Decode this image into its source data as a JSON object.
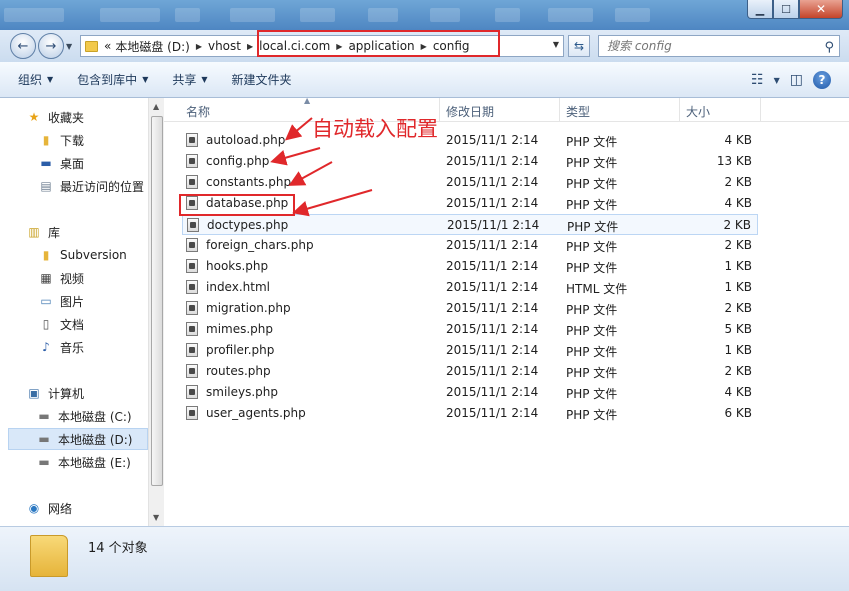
{
  "window": {
    "search_placeholder": "搜索 config"
  },
  "address": {
    "overflow": "«",
    "crumbs": [
      "本地磁盘 (D:)",
      "vhost",
      "local.ci.com",
      "application",
      "config"
    ]
  },
  "toolbar": {
    "organize": "组织",
    "include_in_library": "包含到库中",
    "share": "共享",
    "new_folder": "新建文件夹"
  },
  "sidebar": {
    "items": [
      {
        "label": "收藏夹",
        "icon": "star-icon"
      },
      {
        "label": "下载",
        "icon": "folder-icon"
      },
      {
        "label": "桌面",
        "icon": "desktop-icon"
      },
      {
        "label": "最近访问的位置",
        "icon": "recent-icon"
      },
      {
        "label": "库",
        "icon": "library-icon"
      },
      {
        "label": "Subversion",
        "icon": "folder-icon"
      },
      {
        "label": "视频",
        "icon": "video-icon"
      },
      {
        "label": "图片",
        "icon": "picture-icon"
      },
      {
        "label": "文档",
        "icon": "document-icon"
      },
      {
        "label": "音乐",
        "icon": "music-icon"
      },
      {
        "label": "计算机",
        "icon": "computer-icon"
      },
      {
        "label": "本地磁盘 (C:)",
        "icon": "drive-icon"
      },
      {
        "label": "本地磁盘 (D:)",
        "icon": "drive-icon"
      },
      {
        "label": "本地磁盘 (E:)",
        "icon": "drive-icon"
      },
      {
        "label": "网络",
        "icon": "network-icon"
      }
    ]
  },
  "columns": {
    "name": "名称",
    "modified": "修改日期",
    "type": "类型",
    "size": "大小"
  },
  "files": [
    {
      "name": "autoload.php",
      "modified": "2015/11/1 2:14",
      "type": "PHP 文件",
      "size": "4 KB"
    },
    {
      "name": "config.php",
      "modified": "2015/11/1 2:14",
      "type": "PHP 文件",
      "size": "13 KB"
    },
    {
      "name": "constants.php",
      "modified": "2015/11/1 2:14",
      "type": "PHP 文件",
      "size": "2 KB"
    },
    {
      "name": "database.php",
      "modified": "2015/11/1 2:14",
      "type": "PHP 文件",
      "size": "4 KB"
    },
    {
      "name": "doctypes.php",
      "modified": "2015/11/1 2:14",
      "type": "PHP 文件",
      "size": "2 KB"
    },
    {
      "name": "foreign_chars.php",
      "modified": "2015/11/1 2:14",
      "type": "PHP 文件",
      "size": "2 KB"
    },
    {
      "name": "hooks.php",
      "modified": "2015/11/1 2:14",
      "type": "PHP 文件",
      "size": "1 KB"
    },
    {
      "name": "index.html",
      "modified": "2015/11/1 2:14",
      "type": "HTML 文件",
      "size": "1 KB"
    },
    {
      "name": "migration.php",
      "modified": "2015/11/1 2:14",
      "type": "PHP 文件",
      "size": "2 KB"
    },
    {
      "name": "mimes.php",
      "modified": "2015/11/1 2:14",
      "type": "PHP 文件",
      "size": "5 KB"
    },
    {
      "name": "profiler.php",
      "modified": "2015/11/1 2:14",
      "type": "PHP 文件",
      "size": "1 KB"
    },
    {
      "name": "routes.php",
      "modified": "2015/11/1 2:14",
      "type": "PHP 文件",
      "size": "2 KB"
    },
    {
      "name": "smileys.php",
      "modified": "2015/11/1 2:14",
      "type": "PHP 文件",
      "size": "4 KB"
    },
    {
      "name": "user_agents.php",
      "modified": "2015/11/1 2:14",
      "type": "PHP 文件",
      "size": "6 KB"
    }
  ],
  "annotation": {
    "text": "自动载入配置",
    "color": "#e0282b"
  },
  "status": {
    "count": "14 个对象"
  }
}
